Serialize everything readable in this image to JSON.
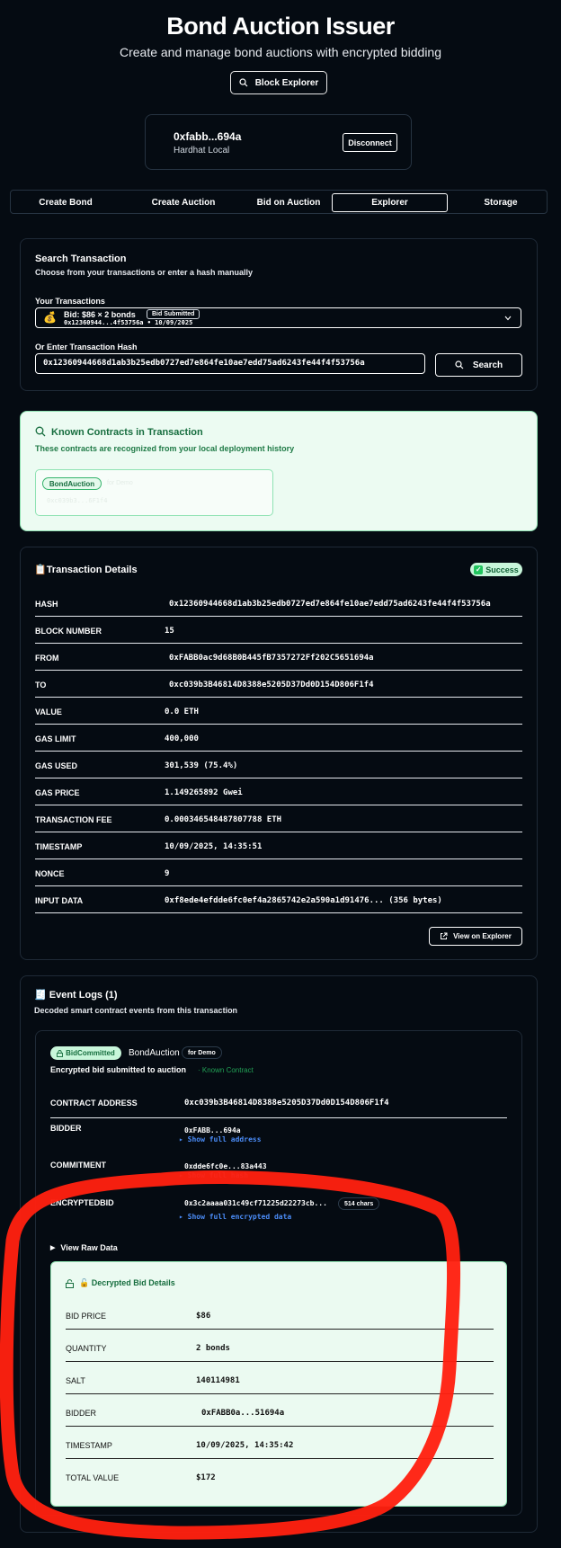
{
  "header": {
    "title": "Bond Auction Issuer",
    "subtitle": "Create and manage bond auctions with encrypted bidding",
    "explorer_button": "Block Explorer"
  },
  "wallet": {
    "address": "0xfabb...694a",
    "network": "Hardhat Local",
    "disconnect_label": "Disconnect"
  },
  "tabs": [
    {
      "label": "Create Bond",
      "active": false
    },
    {
      "label": "Create Auction",
      "active": false
    },
    {
      "label": "Bid on Auction",
      "active": false
    },
    {
      "label": "Explorer",
      "active": true
    },
    {
      "label": "Storage",
      "active": false
    }
  ],
  "search": {
    "title": "Search Transaction",
    "subtitle": "Choose from your transactions or enter a hash manually",
    "your_tx_label": "Your Transactions",
    "selected_tx": {
      "icon": "money-bag-icon",
      "title": "Bid: $86 × 2 bonds",
      "badge": "Bid Submitted",
      "meta": "0x12360944...4f53756a • 10/09/2025"
    },
    "hash_label": "Or Enter Transaction Hash",
    "hash_value": "0x12360944668d1ab3b25edb0727ed7e864fe10ae7edd75ad6243fe44f4f53756a",
    "search_label": "Search"
  },
  "known_contracts": {
    "title": "Known Contracts in Transaction",
    "subtitle": "These contracts are recognized from your local deployment history",
    "chip_name": "BondAuction",
    "chip_tag": "for Demo",
    "chip_addr": "0xc039b3...6F1f4"
  },
  "tx_details": {
    "title": "📋Transaction Details",
    "status": "Success",
    "rows": [
      {
        "k": "HASH",
        "v": "0x12360944668d1ab3b25edb0727ed7e864fe10ae7edd75ad6243fe44f4f53756a"
      },
      {
        "k": "BLOCK NUMBER",
        "v": "15"
      },
      {
        "k": "FROM",
        "v": "0xFABB0ac9d68B0B445fB7357272Ff202C5651694a"
      },
      {
        "k": "TO",
        "v": "0xc039b3B46814D8388e5205D37Dd0D154D806F1f4"
      },
      {
        "k": "VALUE",
        "v": "0.0 ETH"
      },
      {
        "k": "GAS LIMIT",
        "v": "400,000"
      },
      {
        "k": "GAS USED",
        "v": "301,539 (75.4%)"
      },
      {
        "k": "GAS PRICE",
        "v": "1.149265892 Gwei"
      },
      {
        "k": "TRANSACTION FEE",
        "v": "0.000346548487807788 ETH"
      },
      {
        "k": "TIMESTAMP",
        "v": "10/09/2025, 14:35:51"
      },
      {
        "k": "NONCE",
        "v": "9"
      },
      {
        "k": "INPUT DATA",
        "v": "0xf8ede4efdde6fc0ef4a2865742e2a590a1d91476... (356 bytes)"
      }
    ],
    "view_explorer": "View on Explorer"
  },
  "events": {
    "title": "🧾 Event Logs (1)",
    "subtitle": "Decoded smart contract events from this transaction",
    "event_name": "BidCommitted",
    "contract_name": "BondAuction",
    "demo_tag": "for Demo",
    "description": "Encrypted bid submitted to auction",
    "known_tag": "· Known Contract",
    "contract_address_label": "CONTRACT ADDRESS",
    "contract_address": "0xc039b3B46814D8388e5205D37Dd0D154D806F1f4",
    "bidder_label": "BIDDER",
    "bidder": "0xFABB...694a",
    "bidder_link": "▸ Show full address",
    "commitment_label": "COMMITMENT",
    "commitment": "0xdde6fc0e...83a443",
    "commitment_link": "▸ Show full hash",
    "encrypted_label": "ENCRYPTEDBID",
    "encrypted": "0x3c2aaaa031c49cf71225d22273cb...",
    "encrypted_chars": "514 chars",
    "encrypted_link": "▸ Show full encrypted data",
    "raw_toggle": "View Raw Data",
    "decrypted": {
      "title": "🔓 Decrypted Bid Details",
      "rows": [
        {
          "k": "BID PRICE",
          "v": "$86"
        },
        {
          "k": "QUANTITY",
          "v": "2 bonds"
        },
        {
          "k": "SALT",
          "v": "140114981"
        },
        {
          "k": "BIDDER",
          "v": "0xFABB0a...51694a"
        },
        {
          "k": "TIMESTAMP",
          "v": "10/09/2025, 14:35:42"
        },
        {
          "k": "TOTAL VALUE",
          "v": "$172"
        }
      ]
    }
  },
  "colors": {
    "background": "#050b12",
    "success_green": "#166d3e",
    "link_blue": "#4b8cf7",
    "annotation_red": "#ff2010"
  }
}
